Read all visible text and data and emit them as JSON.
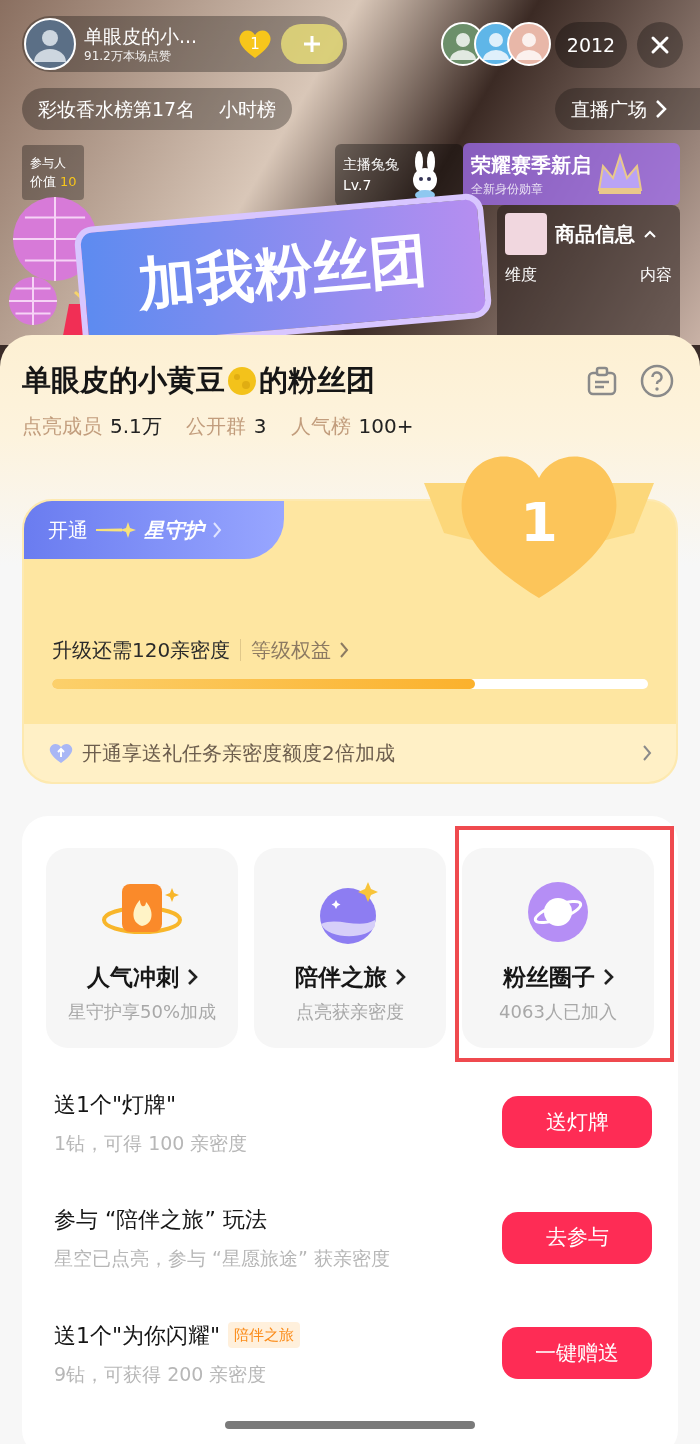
{
  "live": {
    "streamer": {
      "name": "单眼皮的小...",
      "likes": "91.2万本场点赞",
      "fan_level": "1"
    },
    "viewer_count": "2012",
    "ranking": {
      "rank": "彩妆香水榜第17名",
      "board": "小时榜"
    },
    "plaza": "直播广场",
    "stats_panel": {
      "title": "参与人",
      "label": "价值",
      "value": "10"
    },
    "host": {
      "name": "主播兔兔",
      "level": "Lv.7"
    },
    "season": {
      "title": "荣耀赛季新启",
      "subtitle": "全新身份勋章"
    },
    "fan_banner": "加我粉丝团",
    "product": {
      "title": "商品信息",
      "columns": [
        "维度",
        "内容"
      ]
    }
  },
  "fan_club": {
    "name": "单眼皮的小黄豆",
    "suffix": "的粉丝团",
    "stats": [
      {
        "label": "点亮成员",
        "value": "5.1万"
      },
      {
        "label": "公开群",
        "value": "3"
      },
      {
        "label": "人气榜",
        "value": "100+"
      }
    ],
    "level_card": {
      "number": "1",
      "open_label": "开通",
      "guard": "星守护",
      "need": "升级还需120亲密度",
      "benefits": "等级权益",
      "level": 0.71,
      "promo": "开通享送礼任务亲密度额度2倍加成"
    },
    "features": [
      {
        "kind": "fire",
        "title": "人气冲刺",
        "subtitle": "星守护享50%加成",
        "highlighted": false
      },
      {
        "kind": "moon",
        "title": "陪伴之旅",
        "subtitle": "点亮获亲密度",
        "highlighted": false
      },
      {
        "kind": "planet",
        "title": "粉丝圈子",
        "subtitle": "4063人已加入",
        "highlighted": true
      }
    ],
    "tasks": [
      {
        "title": "送1个\"灯牌\"",
        "subtitle": "1钻，可得 100 亲密度",
        "button": "送灯牌"
      },
      {
        "title": "参与 “陪伴之旅” 玩法",
        "subtitle": "星空已点亮，参与 “星愿旅途” 获亲密度",
        "button": "去参与"
      },
      {
        "title": "送1个\"为你闪耀\"",
        "tag": "陪伴之旅",
        "subtitle": "9钻，可获得 200 亲密度",
        "button": "一键赠送"
      }
    ]
  }
}
